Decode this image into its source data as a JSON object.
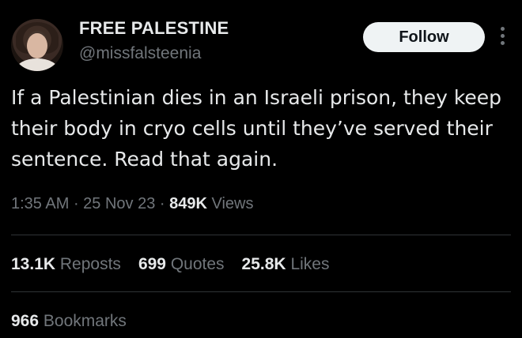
{
  "author": {
    "display_name": "FREE PALESTINE",
    "handle": "@missfalsteenia",
    "avatar_icon": "profile-photo"
  },
  "actions": {
    "follow_label": "Follow",
    "more_icon": "vertical-ellipsis"
  },
  "tweet": {
    "text": "If a Palestinian dies in an Israeli prison, they keep their body in cryo cells until they’ve served their sentence. Read that again.",
    "time": "1:35 AM",
    "date": "25 Nov 23",
    "views_count": "849K",
    "views_label": "Views"
  },
  "stats": {
    "reposts_count": "13.1K",
    "reposts_label": "Reposts",
    "quotes_count": "699",
    "quotes_label": "Quotes",
    "likes_count": "25.8K",
    "likes_label": "Likes",
    "bookmarks_count": "966",
    "bookmarks_label": "Bookmarks"
  },
  "colors": {
    "background": "#000000",
    "primary_text": "#e7e9ea",
    "secondary_text": "#71767b",
    "button_bg": "#eff3f4",
    "divider": "#2f3336"
  }
}
